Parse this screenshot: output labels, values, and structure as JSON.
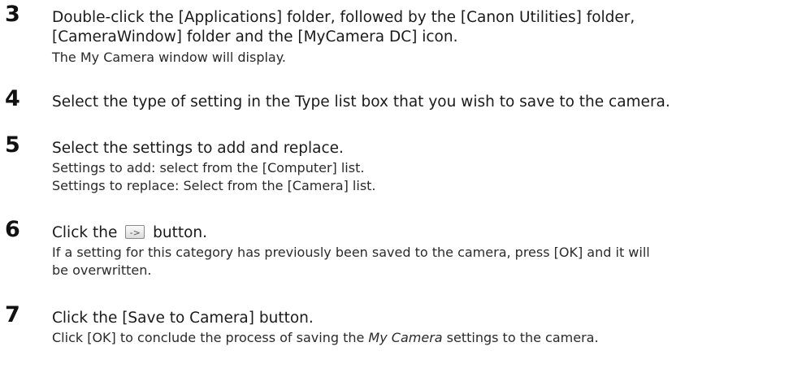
{
  "steps": [
    {
      "number": "3",
      "heading_line1": "Double-click the [Applications] folder, followed by the [Canon Utilities] folder,",
      "heading_line2": "[CameraWindow] folder and the [MyCamera DC] icon.",
      "body": [
        "The My Camera window will display."
      ]
    },
    {
      "number": "4",
      "heading_line1": "Select the type of setting in the Type list box that you wish to save to the camera.",
      "body": []
    },
    {
      "number": "5",
      "heading_line1": "Select the settings to add and replace.",
      "body": [
        "Settings to add: select from the [Computer] list.",
        "Settings to replace: Select from the [Camera] list."
      ]
    },
    {
      "number": "6",
      "heading_before": "Click the",
      "heading_after": "button.",
      "button_glyph": "->",
      "body": [
        "If a setting for this category has previously been saved to the camera, press [OK] and it will",
        "be overwritten."
      ]
    },
    {
      "number": "7",
      "heading_line1": "Click the [Save to Camera] button.",
      "body_before": "Click [OK] to conclude the process of saving the ",
      "body_emph": "My Camera",
      "body_after": " settings to the camera."
    }
  ]
}
